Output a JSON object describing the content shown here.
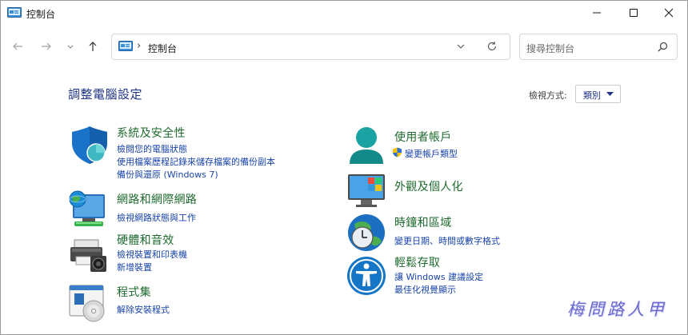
{
  "window": {
    "title": "控制台",
    "minimize_glyph": "─",
    "maximize_glyph": "☐",
    "close_glyph": "✕"
  },
  "nav": {
    "address": "控制台",
    "search_placeholder": "搜尋控制台"
  },
  "header": {
    "title": "調整電腦設定",
    "view_by_label": "檢視方式:",
    "view_by_value": "類別"
  },
  "categories_left": [
    {
      "title": "系統及安全性",
      "icon": "shield-icon",
      "links": [
        "檢閱您的電腦狀態",
        "使用檔案歷程記錄來儲存檔案的備份副本",
        "備份與還原 (Windows 7)"
      ]
    },
    {
      "title": "網路和網際網路",
      "icon": "network-globe-icon",
      "links": [
        "檢視網路狀態與工作"
      ]
    },
    {
      "title": "硬體和音效",
      "icon": "printer-speaker-icon",
      "links": [
        "檢視裝置和印表機",
        "新增裝置"
      ]
    },
    {
      "title": "程式集",
      "icon": "programs-disc-icon",
      "links": [
        "解除安裝程式"
      ]
    }
  ],
  "categories_right": [
    {
      "title": "使用者帳戶",
      "icon": "user-icon",
      "links": [
        "變更帳戶類型"
      ]
    },
    {
      "title": "外觀及個人化",
      "icon": "monitor-palette-icon",
      "links": []
    },
    {
      "title": "時鐘和區域",
      "icon": "clock-globe-icon",
      "links": [
        "變更日期、時間或數字格式"
      ]
    },
    {
      "title": "輕鬆存取",
      "icon": "accessibility-icon",
      "links": [
        "讓 Windows 建議設定",
        "最佳化視覺顯示"
      ]
    }
  ],
  "watermark": "梅問路人甲",
  "colors": {
    "category_title": "#1e6a2e",
    "link": "#1a44a8",
    "page_title": "#1e3287"
  }
}
